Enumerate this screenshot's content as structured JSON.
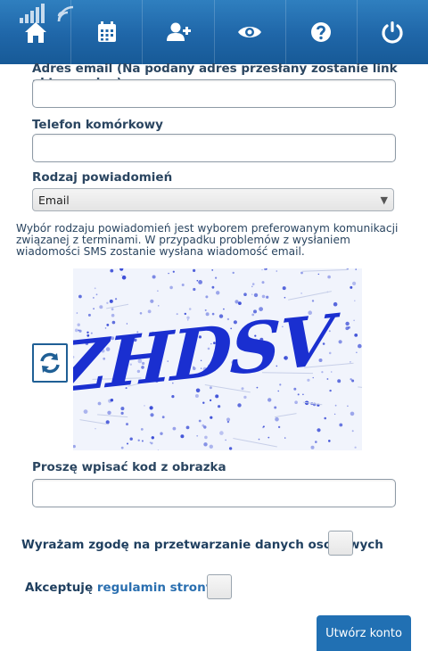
{
  "nav": {
    "items": [
      {
        "name": "home",
        "icon": "home-icon"
      },
      {
        "name": "calendar",
        "icon": "calendar-icon"
      },
      {
        "name": "add-user",
        "icon": "add-user-icon"
      },
      {
        "name": "view",
        "icon": "eye-icon"
      },
      {
        "name": "help",
        "icon": "question-icon"
      },
      {
        "name": "logout",
        "icon": "power-icon"
      }
    ],
    "status_icon": "signal-icon"
  },
  "form": {
    "email_label": "Adres email (Na podany adres przesłany zostanie link aktywacyjny)",
    "email_value": "",
    "phone_label": "Telefon komórkowy",
    "phone_value": "",
    "notification_label": "Rodzaj powiadomień",
    "notification_selected": "Email",
    "notification_info": "Wybór rodzaju powiadomień jest wyborem preferowanym komunikacji związanej z terminami. W przypadku problemów z wysłaniem wiadomości SMS zostanie wysłana wiadomość email.",
    "captcha_text": "ZHDSV",
    "captcha_label": "Proszę wpisać kod z obrazka",
    "captcha_value": "",
    "consent_data": "Wyrażam zgodę na przetwarzanie danych osobowych",
    "consent_data_checked": false,
    "accept_prefix": "Akceptuję",
    "accept_link": "regulamin strony",
    "accept_checked": false,
    "submit_label": "Utwórz konto"
  },
  "colors": {
    "nav_bg": "#1f66a8",
    "accent": "#2170b3",
    "captcha_ink": "#1a2fd0"
  }
}
